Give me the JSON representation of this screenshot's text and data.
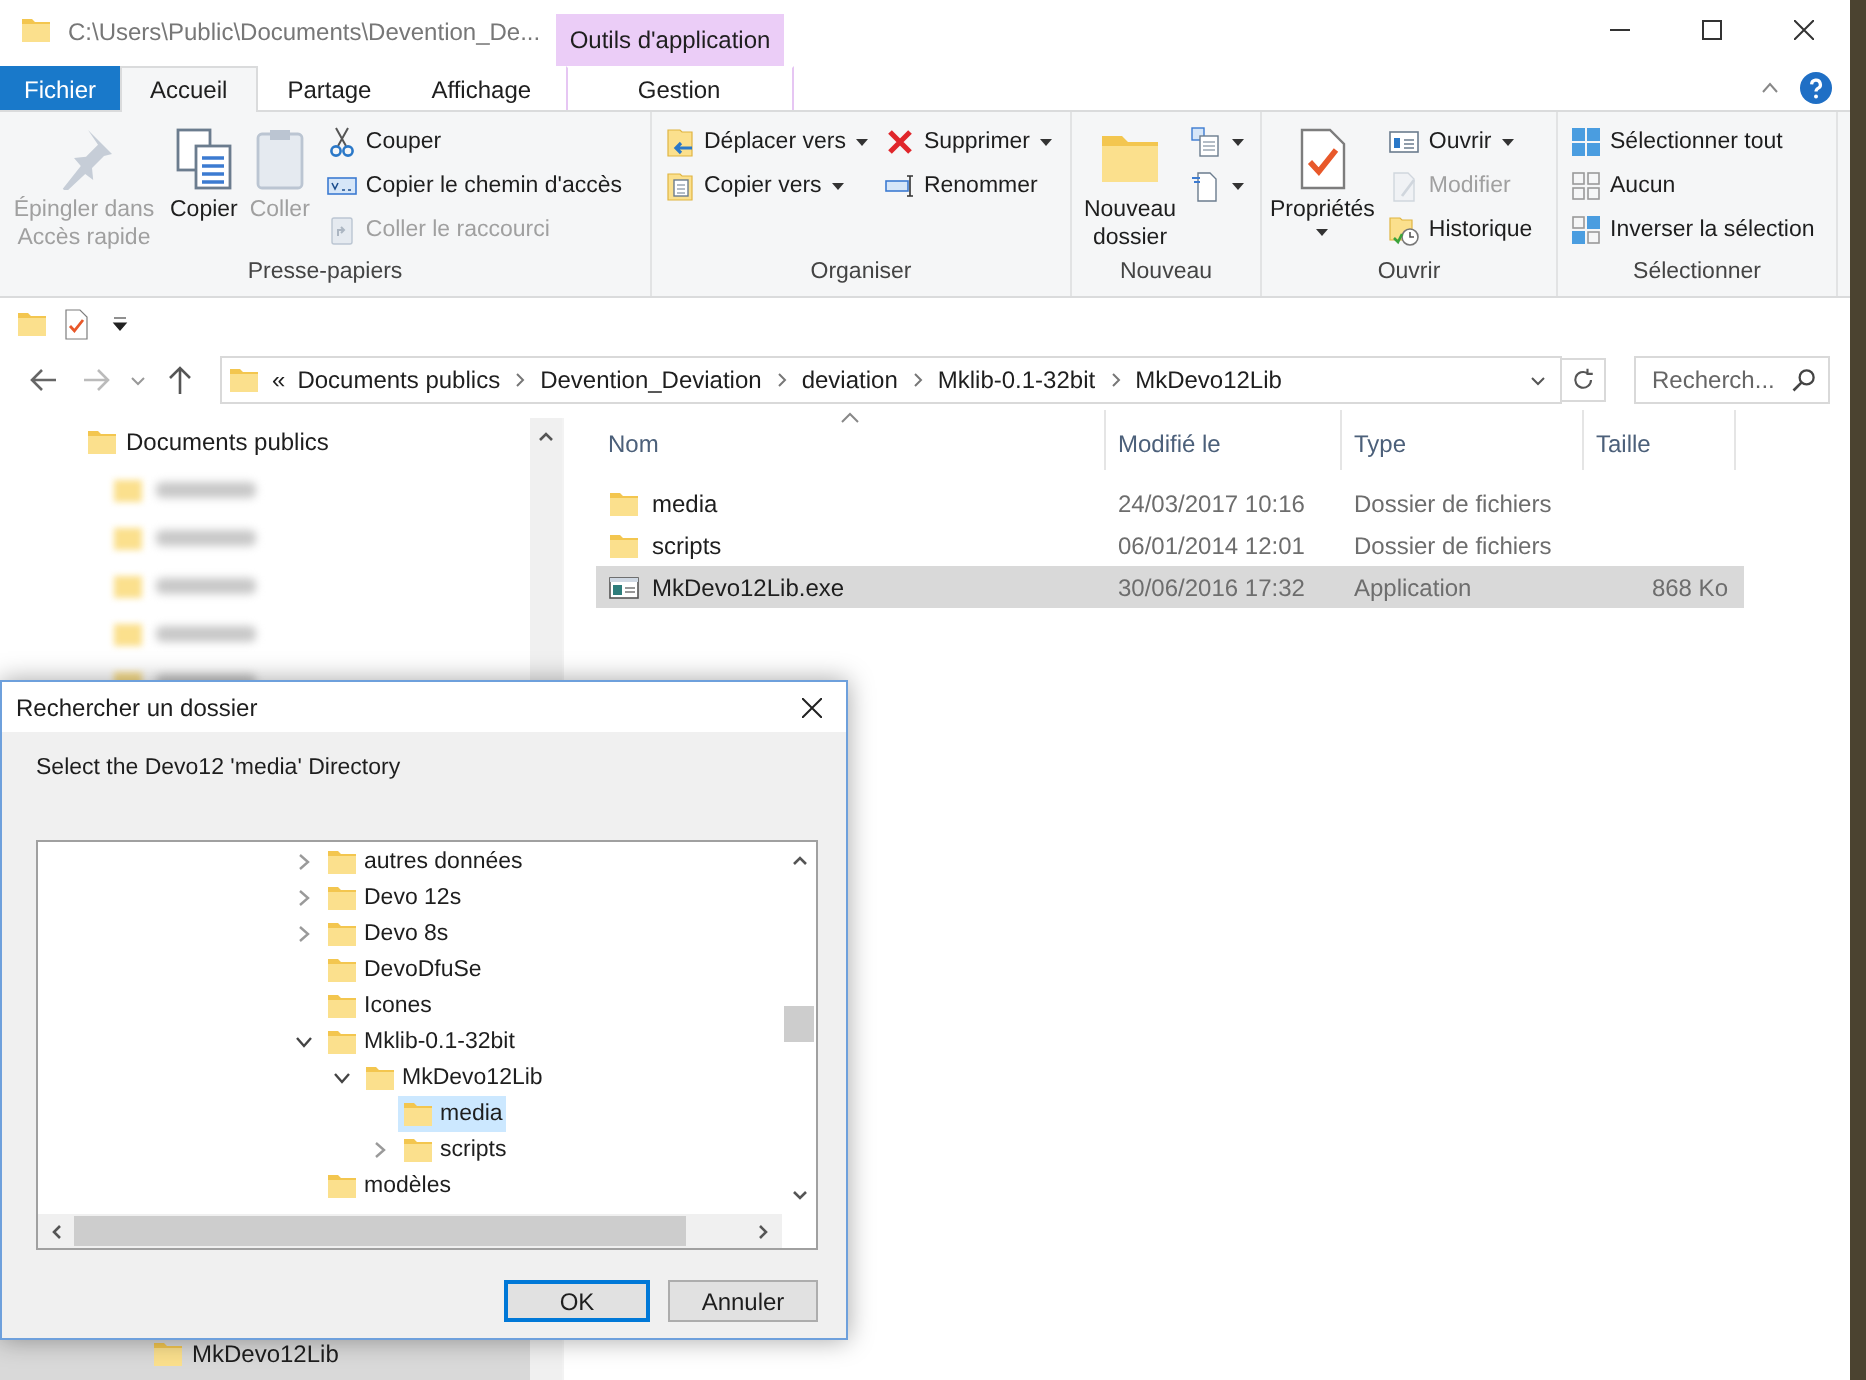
{
  "window": {
    "title": "C:\\Users\\Public\\Documents\\Devention_De...",
    "context_tab_group": "Outils d'application"
  },
  "ribbon_tabs": [
    {
      "label": "Fichier",
      "kind": "file",
      "selected": false
    },
    {
      "label": "Accueil",
      "kind": "tab",
      "selected": true
    },
    {
      "label": "Partage",
      "kind": "tab",
      "selected": false
    },
    {
      "label": "Affichage",
      "kind": "tab",
      "selected": false
    },
    {
      "label": "Gestion",
      "kind": "context",
      "selected": false
    }
  ],
  "ribbon_groups": [
    {
      "title": "Presse-papiers",
      "columns": [
        {
          "kind": "large",
          "commands": [
            {
              "label": "Épingler dans Accès rapide",
              "kind": "pin",
              "disabled": true,
              "dropdown": false
            }
          ]
        },
        {
          "kind": "large",
          "commands": [
            {
              "label": "Copier",
              "kind": "copy",
              "disabled": false,
              "dropdown": false
            }
          ]
        },
        {
          "kind": "large",
          "commands": [
            {
              "label": "Coller",
              "kind": "paste",
              "disabled": true,
              "dropdown": false
            }
          ]
        },
        {
          "kind": "small",
          "commands": [
            {
              "label": "Couper",
              "kind": "cut",
              "disabled": false,
              "dropdown": false
            },
            {
              "label": "Copier le chemin d'accès",
              "kind": "copy-path",
              "disabled": false,
              "dropdown": false
            },
            {
              "label": "Coller le raccourci",
              "kind": "paste-shortcut",
              "disabled": true,
              "dropdown": false
            }
          ]
        }
      ]
    },
    {
      "title": "Organiser",
      "columns": [
        {
          "kind": "small",
          "commands": [
            {
              "label": "Déplacer vers",
              "kind": "move-to",
              "disabled": false,
              "dropdown": true
            },
            {
              "label": "Copier vers",
              "kind": "copy-to",
              "disabled": false,
              "dropdown": true
            }
          ]
        },
        {
          "kind": "small",
          "commands": [
            {
              "label": "Supprimer",
              "kind": "delete",
              "disabled": false,
              "dropdown": true
            },
            {
              "label": "Renommer",
              "kind": "rename",
              "disabled": false,
              "dropdown": false
            }
          ]
        }
      ]
    },
    {
      "title": "Nouveau",
      "columns": [
        {
          "kind": "large",
          "commands": [
            {
              "label": "Nouveau dossier",
              "kind": "new-folder",
              "disabled": false,
              "dropdown": false
            }
          ]
        },
        {
          "kind": "small",
          "commands": [
            {
              "kind": "new-item",
              "disabled": false,
              "dropdown": true
            },
            {
              "kind": "easy-access",
              "disabled": false,
              "dropdown": true
            }
          ]
        }
      ]
    },
    {
      "title": "Ouvrir",
      "columns": [
        {
          "kind": "large",
          "commands": [
            {
              "label": "Propriétés",
              "kind": "properties",
              "disabled": false,
              "dropdown": true
            }
          ]
        },
        {
          "kind": "small",
          "commands": [
            {
              "label": "Ouvrir",
              "kind": "open",
              "disabled": false,
              "dropdown": true
            },
            {
              "label": "Modifier",
              "kind": "edit",
              "disabled": true,
              "dropdown": false
            },
            {
              "label": "Historique",
              "kind": "history",
              "disabled": false,
              "dropdown": false
            }
          ]
        }
      ]
    },
    {
      "title": "Sélectionner",
      "columns": [
        {
          "kind": "small",
          "commands": [
            {
              "label": "Sélectionner tout",
              "kind": "select-all",
              "disabled": false,
              "dropdown": false
            },
            {
              "label": "Aucun",
              "kind": "select-none",
              "disabled": false,
              "dropdown": false
            },
            {
              "label": "Inverser la sélection",
              "kind": "invert-selection",
              "disabled": false,
              "dropdown": false
            }
          ]
        }
      ]
    }
  ],
  "address": {
    "overflow": "«",
    "crumbs": [
      "Documents publics",
      "Devention_Deviation",
      "deviation",
      "Mklib-0.1-32bit",
      "MkDevo12Lib"
    ]
  },
  "search": {
    "placeholder": "Recherch..."
  },
  "nav_pane": {
    "items": [
      {
        "label": "Documents publics",
        "selected": false,
        "children": [
          {
            "kind": "blurred"
          },
          {
            "kind": "blurred"
          },
          {
            "kind": "blurred"
          },
          {
            "kind": "blurred"
          },
          {
            "kind": "blurred"
          }
        ]
      }
    ],
    "bottom_item": {
      "label": "MkDevo12Lib",
      "selected": true
    }
  },
  "file_list": {
    "columns": [
      {
        "label": "Nom",
        "sorted": true
      },
      {
        "label": "Modifié le",
        "sorted": false
      },
      {
        "label": "Type",
        "sorted": false
      },
      {
        "label": "Taille",
        "sorted": false
      }
    ],
    "rows": [
      {
        "kind": "folder",
        "name": "media",
        "modified": "24/03/2017 10:16",
        "type": "Dossier de fichiers",
        "selected": false
      },
      {
        "kind": "folder",
        "name": "scripts",
        "modified": "06/01/2014 12:01",
        "type": "Dossier de fichiers",
        "selected": false
      },
      {
        "kind": "app",
        "name": "MkDevo12Lib.exe",
        "modified": "30/06/2016 17:32",
        "type": "Application",
        "size": "868 Ko",
        "selected": true
      }
    ]
  },
  "dialog": {
    "title": "Rechercher un dossier",
    "message": "Select the Devo12 'media' Directory",
    "tree": [
      {
        "label": "autres données",
        "kind": "collapsed",
        "selected": false
      },
      {
        "label": "Devo 12s",
        "kind": "collapsed",
        "selected": false
      },
      {
        "label": "Devo 8s",
        "kind": "collapsed",
        "selected": false
      },
      {
        "label": "DevoDfuSe",
        "kind": "leaf",
        "selected": false
      },
      {
        "label": "Icones",
        "kind": "leaf",
        "selected": false
      },
      {
        "label": "Mklib-0.1-32bit",
        "kind": "expanded",
        "selected": false,
        "children": [
          {
            "label": "MkDevo12Lib",
            "kind": "expanded",
            "selected": false,
            "children": [
              {
                "label": "media",
                "kind": "leaf",
                "selected": true
              },
              {
                "label": "scripts",
                "kind": "collapsed",
                "selected": false
              }
            ]
          }
        ]
      },
      {
        "label": "modèles",
        "kind": "leaf",
        "selected": false
      }
    ],
    "buttons": [
      {
        "label": "OK",
        "kind": "default"
      },
      {
        "label": "Annuler",
        "kind": "normal"
      }
    ]
  }
}
